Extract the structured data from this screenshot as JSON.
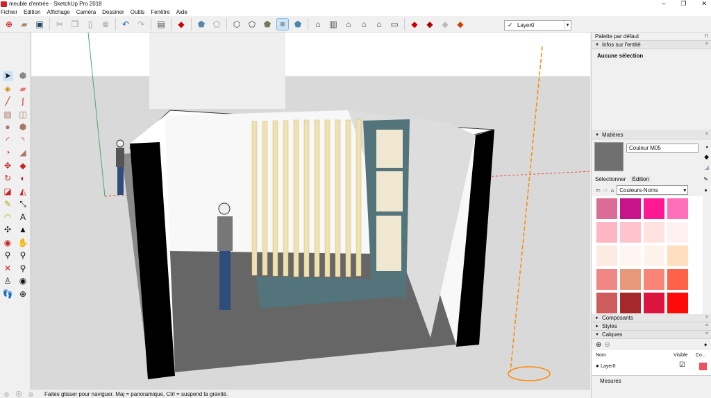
{
  "window": {
    "title": "meuble d'entrée - SketchUp Pro 2018",
    "min": "–",
    "max": "❐",
    "close": "✕"
  },
  "menu": [
    "Fichier",
    "Edition",
    "Affichage",
    "Caméra",
    "Dessiner",
    "Outils",
    "Fenêtre",
    "Aide"
  ],
  "toolbar": {
    "layer_value": "Layer0",
    "layer_check": "✓",
    "dropdown": "▾"
  },
  "status": {
    "text": "Faites glisser pour naviguer. Maj = panoramique, Ctrl = suspend la gravité.",
    "measures_label": "Mesures"
  },
  "panel": {
    "title": "Palette par défaut",
    "pin": "⊓",
    "entity_info": {
      "title": "Infos sur l'entité",
      "value": "Aucune sélection"
    },
    "materials": {
      "title": "Matières",
      "name_value": "Couleur M05",
      "tab_select": "Sélectionner",
      "tab_edit": "Édition",
      "library": "Couleurs-Noms",
      "preview_color": "#707070",
      "swatches": [
        "#db6b97",
        "#c8148a",
        "#ff1a93",
        "#ff6fba",
        "#ffb6c4",
        "#ffc3cd",
        "#ffe2e0",
        "#fff0f4",
        "#fdebe2",
        "#fdf6f2",
        "#fff3ec",
        "#ffdfbf",
        "#f08686",
        "#e8997c",
        "#fa8475",
        "#ff6249",
        "#cd5c5c",
        "#a5282a",
        "#dc153e",
        "#ff0a0a",
        "#b22222",
        "#8b1010",
        "#c3243a",
        "#ff4a10"
      ]
    },
    "components": {
      "title": "Composants"
    },
    "styles": {
      "title": "Styles"
    },
    "layers": {
      "title": "Calques",
      "col_name": "Nom",
      "col_visible": "Visible",
      "col_color": "Co...",
      "rows": [
        {
          "name": "Layer0",
          "visible": "☑",
          "color": "#f05060"
        }
      ]
    },
    "close": "×"
  }
}
